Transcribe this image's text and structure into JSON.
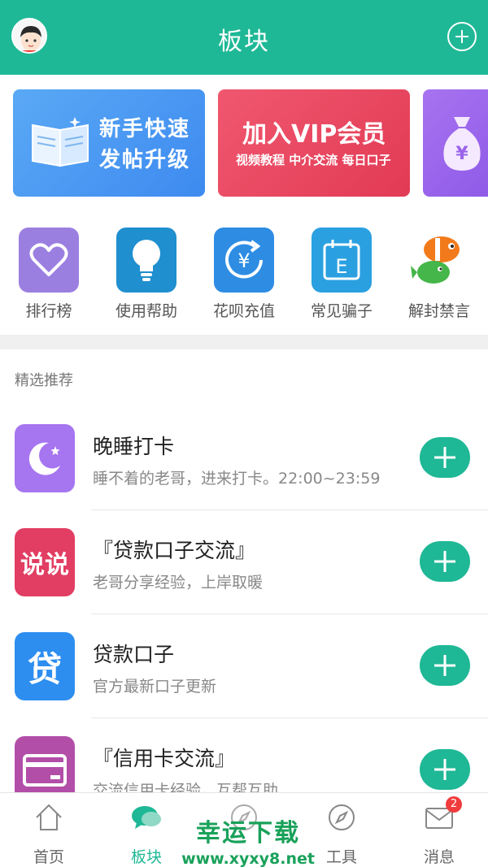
{
  "header": {
    "title": "板块"
  },
  "banners": [
    {
      "line1": "新手快速",
      "line2": "发帖升级",
      "color": "#4a9af2"
    },
    {
      "line1": "加入VIP会员",
      "line2": "视频教程 中介交流 每日口子",
      "color": "#e94a62"
    },
    {
      "line1": "",
      "line2": "",
      "color": "#9a63ea"
    }
  ],
  "quick": [
    {
      "label": "排行榜",
      "icon": "heart-icon",
      "color": "#9b7fe0"
    },
    {
      "label": "使用帮助",
      "icon": "lightbulb-icon",
      "color": "#1f8fcf"
    },
    {
      "label": "花呗充值",
      "icon": "yuan-refresh-icon",
      "color": "#2e8de3"
    },
    {
      "label": "常见骗子",
      "icon": "calendar-letter-icon",
      "color": "#2aa0e0"
    },
    {
      "label": "解封禁言",
      "icon": "clownfish-icon",
      "color": "#f27a1a"
    }
  ],
  "section": {
    "title": "精选推荐"
  },
  "rows": [
    {
      "title": "晚睡打卡",
      "subtitle": "睡不着的老哥，进来打卡。22:00~23:59",
      "icon": "moon-icon",
      "color": "#a675f0"
    },
    {
      "title": "『贷款口子交流』",
      "subtitle": "老哥分享经验，上岸取暖",
      "icon_text": "说说",
      "color": "#e23d62"
    },
    {
      "title": "贷款口子",
      "subtitle": "官方最新口子更新",
      "icon_text": "贷",
      "color": "#2d8ef0"
    },
    {
      "title": "『信用卡交流』",
      "subtitle": "交流信用卡经验，互帮互助",
      "icon": "card-icon",
      "color": "#b24ea8"
    }
  ],
  "tabs": [
    {
      "label": "首页",
      "icon": "home-icon"
    },
    {
      "label": "板块",
      "icon": "chat-bubbles-icon",
      "active": true
    },
    {
      "label": "",
      "icon": "compass-circle-icon"
    },
    {
      "label": "工具",
      "icon": "compass-icon"
    },
    {
      "label": "消息",
      "icon": "mail-icon",
      "badge": "2"
    }
  ],
  "watermark": {
    "line1": "幸运下载",
    "line2": "www.xyxy8.net"
  },
  "colors": {
    "accent": "#1fb896",
    "badge": "#f03c3c"
  }
}
